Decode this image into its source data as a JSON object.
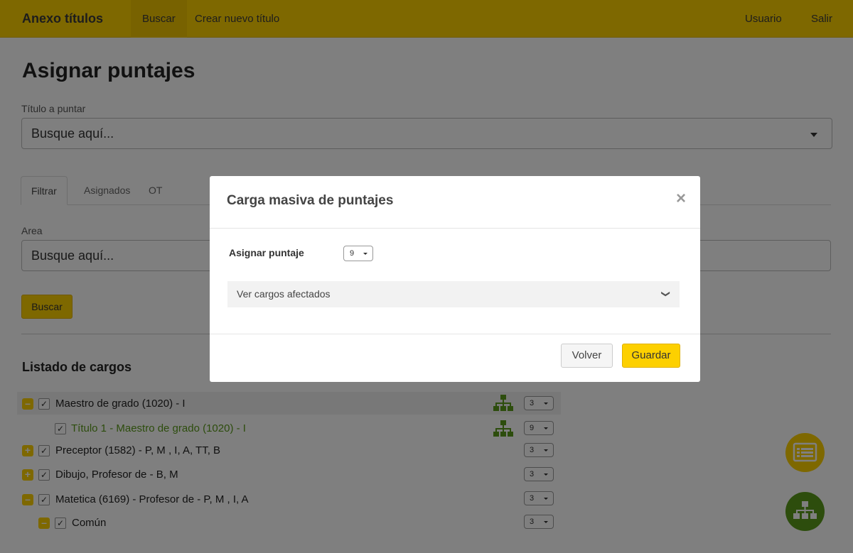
{
  "navbar": {
    "brand": "Anexo títulos",
    "items": [
      "Buscar",
      "Crear nuevo título"
    ],
    "right_items": [
      "Usuario",
      "Salir"
    ]
  },
  "page": {
    "title": "Asignar puntajes",
    "titulo_label": "Título a puntar",
    "titulo_placeholder": "Busque aquí...",
    "tabs": [
      "Filtrar",
      "Asignados",
      "OT"
    ],
    "area_label": "Area",
    "area_placeholder": "Busque aquí...",
    "search_button": "Buscar",
    "list_title": "Listado de cargos"
  },
  "rows": [
    {
      "text": "Maestro de grado (1020) - I",
      "score": "3",
      "toggle": "–",
      "checked": "✓"
    },
    {
      "text": "Título 1 - Maestro de grado (1020) - I",
      "score": "9",
      "checked": "✓"
    },
    {
      "text": "Preceptor (1582) - P, M , I, A, TT, B",
      "score": "3",
      "toggle": "+",
      "checked": "✓"
    },
    {
      "text": "Dibujo, Profesor de - B, M",
      "score": "3",
      "toggle": "+",
      "checked": "✓"
    },
    {
      "text": "Matetica (6169) - Profesor de - P, M , I, A",
      "score": "3",
      "toggle": "–",
      "checked": "✓"
    },
    {
      "text": "Común",
      "score": "3",
      "toggle": "–",
      "checked": "✓"
    }
  ],
  "modal": {
    "title": "Carga masiva de puntajes",
    "close": "×",
    "assign_label": "Asignar puntaje",
    "assign_value": "9",
    "accordion": "Ver cargos afectados",
    "back_button": "Volver",
    "save_button": "Guardar"
  },
  "colors": {
    "brand_yellow": "#fdd000",
    "green": "#5a9a1a"
  }
}
